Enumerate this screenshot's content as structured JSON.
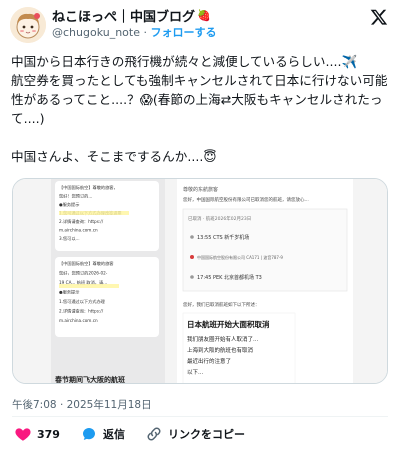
{
  "author": {
    "display_name": "ねこほっぺ｜中国ブログ",
    "name_emoji": "🍓",
    "handle": "@chugoku_note",
    "separator": "·",
    "follow_label": "フォローする"
  },
  "tweet": {
    "text": "中国から日本行きの飛行機が続々と減便しているらしい....✈️\n航空券を買ったとしても強制キャンセルされて日本に行けない可能性があるってこと....？😱(春節の上海⇄大阪もキャンセルされたって....)\n\n中国さんよ、そこまでするんか....😇"
  },
  "media": {
    "left_panel": {
      "lines": [
        "【中国国际航空】尊敬的旅客，",
        "您好！您预订的...",
        "●服务提示",
        "1.您可通过以下方式办理改签退票",
        "2.详情请查询：https://",
        "m.airchina.com.cn",
        "3.您可以...",
        "【中国国际航空】尊敬的旅客",
        "您好，您预订的2026-02-",
        "19 CA... 航班 取消，请...",
        "●服务提示",
        "1.您可通过以下方式办理",
        "2.详情请查询：https://",
        "m.airchina.com.cn"
      ],
      "bottom_caption": "春节期间飞大阪的航班"
    },
    "right_panel": {
      "greeting": "尊敬的东航旅客",
      "notice": "您好，中国国际航空股份有限公司已取消您的航班，请您放心...",
      "flight_date": "已取消 · 航班2026年02月23日",
      "departure": "13:55  CTS 新千岁机场",
      "carrier": "中国国际航空股份有限公司 CA171 | 波音787-9",
      "arrival": "17:45  PEK 北京首都机场 T3",
      "note": "您好，我们已取消航班如下以下所述：",
      "headline": "日本航班开始大面积取消",
      "body_lines": [
        "我们朋友圈开始有人取消了...",
        "上海到大阪的航班也有取消",
        "最近出行的注意了",
        "以下..."
      ]
    }
  },
  "meta": {
    "time": "午後7:08",
    "separator": "·",
    "date": "2025年11月18日"
  },
  "actions": {
    "like_count": "379",
    "reply_label": "返信",
    "copy_link_label": "リンクをコピー"
  },
  "colors": {
    "accent": "#1d9bf0",
    "like": "#f91880",
    "text": "#0f1419",
    "muted": "#536471"
  }
}
